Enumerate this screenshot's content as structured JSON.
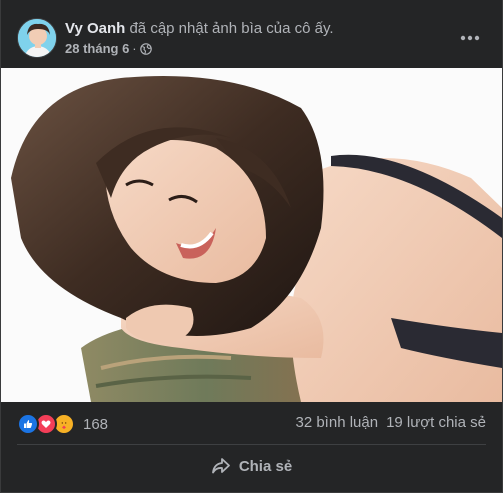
{
  "post": {
    "author": {
      "name": "Vy Oanh",
      "action": "đã cập nhật ảnh bìa của cô ấy."
    },
    "timestamp": "28 tháng 6",
    "separator": "·",
    "privacy_icon": "globe-icon",
    "menu_icon": "more-horizontal-icon",
    "photo": {
      "description_icon": "cover-photo"
    }
  },
  "stats": {
    "reaction_icons": [
      "like-icon",
      "love-icon",
      "care-icon"
    ],
    "reaction_count": "168",
    "comments": "32 bình luận",
    "shares": "19 lượt chia sẻ"
  },
  "actions": {
    "share_label": "Chia sẻ",
    "share_icon": "share-arrow-icon"
  },
  "colors": {
    "background": "#242526",
    "text_primary": "#e4e6eb",
    "text_secondary": "#b0b3b8",
    "like_blue": "#1b74e4",
    "love_red": "#f33e58",
    "care_yellow": "#f7b125"
  }
}
